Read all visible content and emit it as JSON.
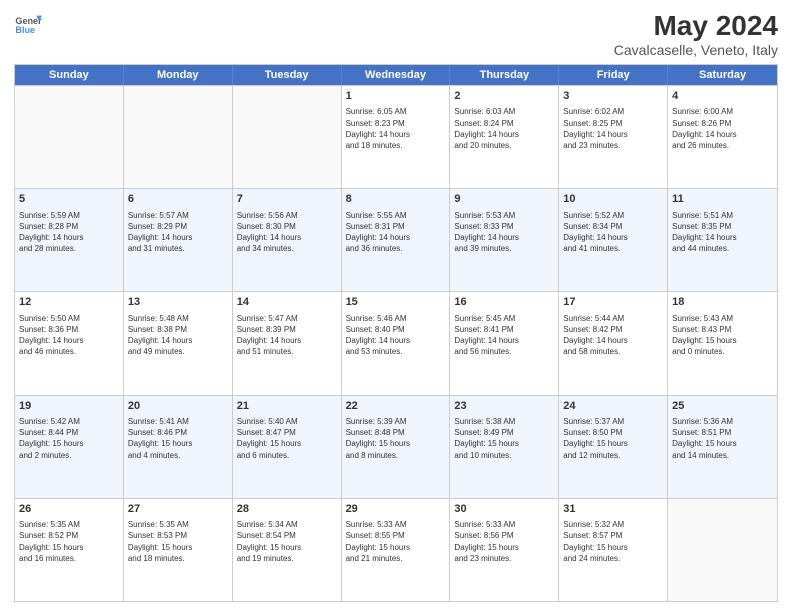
{
  "header": {
    "logo_line1": "General",
    "logo_line2": "Blue",
    "title": "May 2024",
    "subtitle": "Cavalcaselle, Veneto, Italy"
  },
  "days_of_week": [
    "Sunday",
    "Monday",
    "Tuesday",
    "Wednesday",
    "Thursday",
    "Friday",
    "Saturday"
  ],
  "rows": [
    [
      {
        "day": "",
        "text": ""
      },
      {
        "day": "",
        "text": ""
      },
      {
        "day": "",
        "text": ""
      },
      {
        "day": "1",
        "text": "Sunrise: 6:05 AM\nSunset: 8:23 PM\nDaylight: 14 hours\nand 18 minutes."
      },
      {
        "day": "2",
        "text": "Sunrise: 6:03 AM\nSunset: 8:24 PM\nDaylight: 14 hours\nand 20 minutes."
      },
      {
        "day": "3",
        "text": "Sunrise: 6:02 AM\nSunset: 8:25 PM\nDaylight: 14 hours\nand 23 minutes."
      },
      {
        "day": "4",
        "text": "Sunrise: 6:00 AM\nSunset: 8:26 PM\nDaylight: 14 hours\nand 26 minutes."
      }
    ],
    [
      {
        "day": "5",
        "text": "Sunrise: 5:59 AM\nSunset: 8:28 PM\nDaylight: 14 hours\nand 28 minutes."
      },
      {
        "day": "6",
        "text": "Sunrise: 5:57 AM\nSunset: 8:29 PM\nDaylight: 14 hours\nand 31 minutes."
      },
      {
        "day": "7",
        "text": "Sunrise: 5:56 AM\nSunset: 8:30 PM\nDaylight: 14 hours\nand 34 minutes."
      },
      {
        "day": "8",
        "text": "Sunrise: 5:55 AM\nSunset: 8:31 PM\nDaylight: 14 hours\nand 36 minutes."
      },
      {
        "day": "9",
        "text": "Sunrise: 5:53 AM\nSunset: 8:33 PM\nDaylight: 14 hours\nand 39 minutes."
      },
      {
        "day": "10",
        "text": "Sunrise: 5:52 AM\nSunset: 8:34 PM\nDaylight: 14 hours\nand 41 minutes."
      },
      {
        "day": "11",
        "text": "Sunrise: 5:51 AM\nSunset: 8:35 PM\nDaylight: 14 hours\nand 44 minutes."
      }
    ],
    [
      {
        "day": "12",
        "text": "Sunrise: 5:50 AM\nSunset: 8:36 PM\nDaylight: 14 hours\nand 46 minutes."
      },
      {
        "day": "13",
        "text": "Sunrise: 5:48 AM\nSunset: 8:38 PM\nDaylight: 14 hours\nand 49 minutes."
      },
      {
        "day": "14",
        "text": "Sunrise: 5:47 AM\nSunset: 8:39 PM\nDaylight: 14 hours\nand 51 minutes."
      },
      {
        "day": "15",
        "text": "Sunrise: 5:46 AM\nSunset: 8:40 PM\nDaylight: 14 hours\nand 53 minutes."
      },
      {
        "day": "16",
        "text": "Sunrise: 5:45 AM\nSunset: 8:41 PM\nDaylight: 14 hours\nand 56 minutes."
      },
      {
        "day": "17",
        "text": "Sunrise: 5:44 AM\nSunset: 8:42 PM\nDaylight: 14 hours\nand 58 minutes."
      },
      {
        "day": "18",
        "text": "Sunrise: 5:43 AM\nSunset: 8:43 PM\nDaylight: 15 hours\nand 0 minutes."
      }
    ],
    [
      {
        "day": "19",
        "text": "Sunrise: 5:42 AM\nSunset: 8:44 PM\nDaylight: 15 hours\nand 2 minutes."
      },
      {
        "day": "20",
        "text": "Sunrise: 5:41 AM\nSunset: 8:46 PM\nDaylight: 15 hours\nand 4 minutes."
      },
      {
        "day": "21",
        "text": "Sunrise: 5:40 AM\nSunset: 8:47 PM\nDaylight: 15 hours\nand 6 minutes."
      },
      {
        "day": "22",
        "text": "Sunrise: 5:39 AM\nSunset: 8:48 PM\nDaylight: 15 hours\nand 8 minutes."
      },
      {
        "day": "23",
        "text": "Sunrise: 5:38 AM\nSunset: 8:49 PM\nDaylight: 15 hours\nand 10 minutes."
      },
      {
        "day": "24",
        "text": "Sunrise: 5:37 AM\nSunset: 8:50 PM\nDaylight: 15 hours\nand 12 minutes."
      },
      {
        "day": "25",
        "text": "Sunrise: 5:36 AM\nSunset: 8:51 PM\nDaylight: 15 hours\nand 14 minutes."
      }
    ],
    [
      {
        "day": "26",
        "text": "Sunrise: 5:35 AM\nSunset: 8:52 PM\nDaylight: 15 hours\nand 16 minutes."
      },
      {
        "day": "27",
        "text": "Sunrise: 5:35 AM\nSunset: 8:53 PM\nDaylight: 15 hours\nand 18 minutes."
      },
      {
        "day": "28",
        "text": "Sunrise: 5:34 AM\nSunset: 8:54 PM\nDaylight: 15 hours\nand 19 minutes."
      },
      {
        "day": "29",
        "text": "Sunrise: 5:33 AM\nSunset: 8:55 PM\nDaylight: 15 hours\nand 21 minutes."
      },
      {
        "day": "30",
        "text": "Sunrise: 5:33 AM\nSunset: 8:56 PM\nDaylight: 15 hours\nand 23 minutes."
      },
      {
        "day": "31",
        "text": "Sunrise: 5:32 AM\nSunset: 8:57 PM\nDaylight: 15 hours\nand 24 minutes."
      },
      {
        "day": "",
        "text": ""
      }
    ]
  ]
}
